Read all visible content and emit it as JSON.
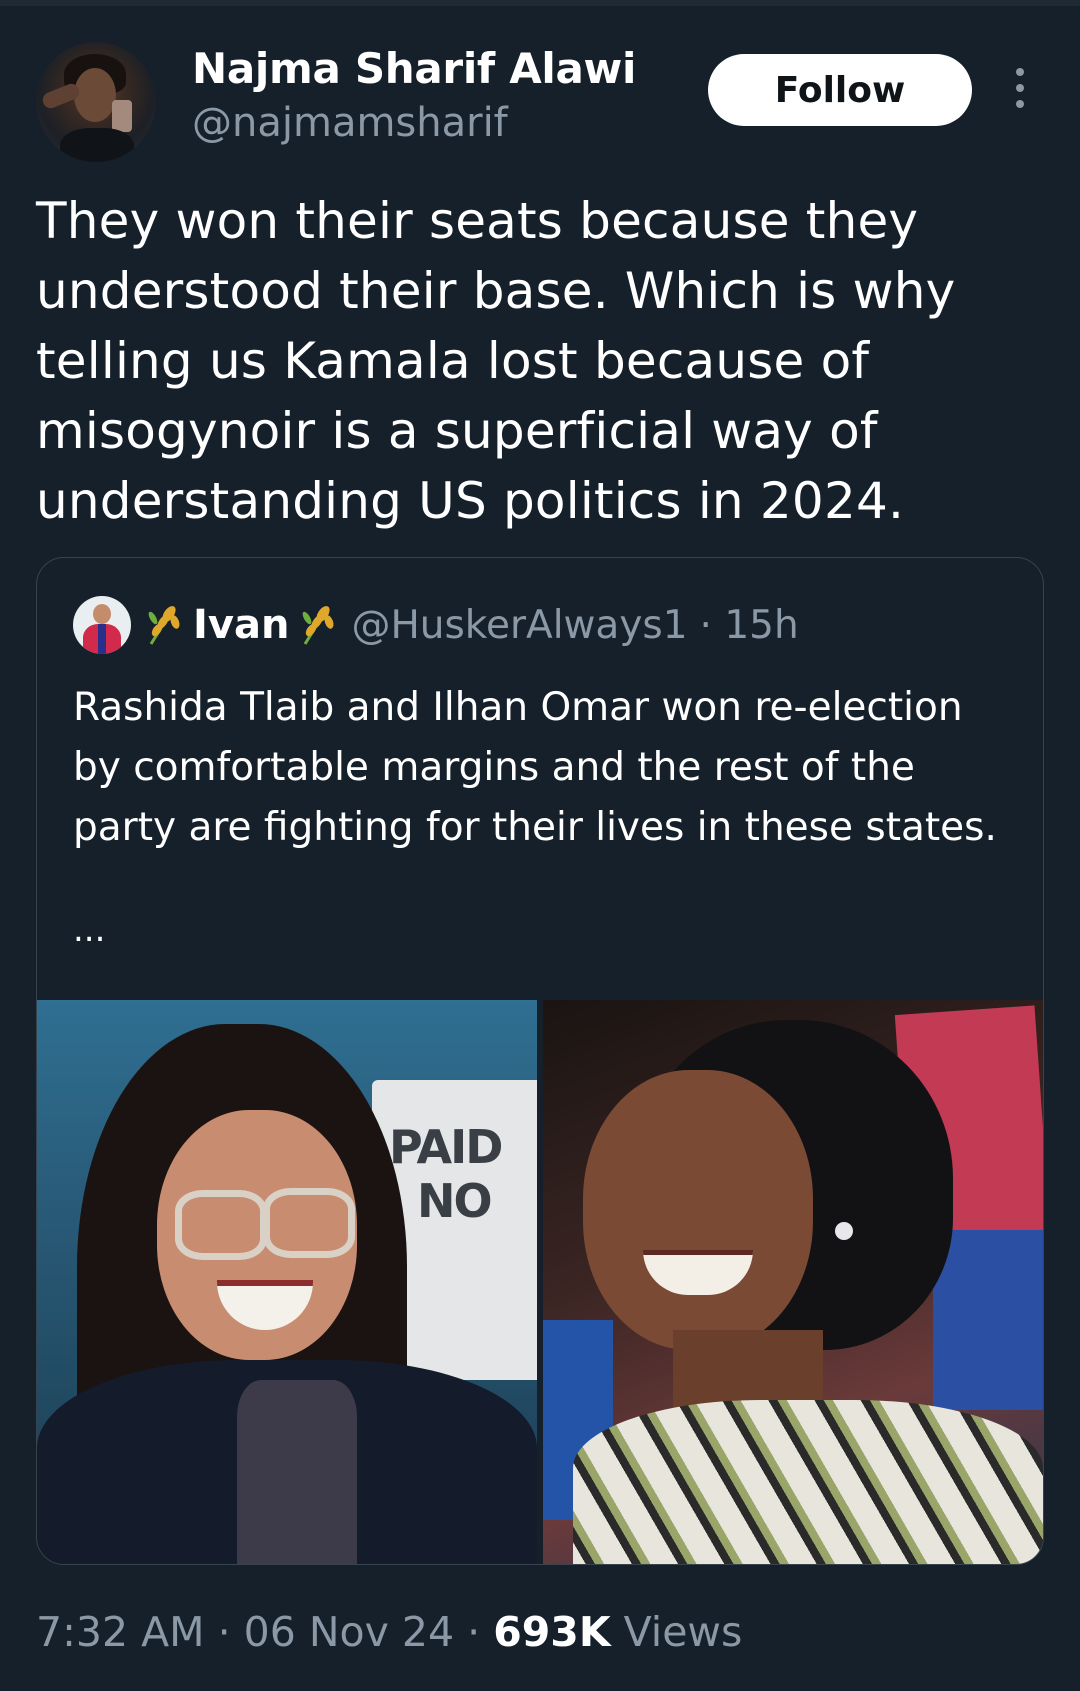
{
  "tweet": {
    "author": {
      "display_name": "Najma Sharif Alawi",
      "handle": "@najmamsharif",
      "avatar": "profile-photo"
    },
    "follow_label": "Follow",
    "more_icon": "more-vertical-icon",
    "text": "They won their seats because they understood their base. Which is why telling us Kamala lost because of misogynoir is a superficial way of understanding US politics in 2024.",
    "time": "7:32 AM",
    "date": "06 Nov 24",
    "separator": "·",
    "views_count": "693K",
    "views_label": "Views"
  },
  "quoted_tweet": {
    "display_name": "Ivan",
    "name_emoji": "wheat-icon",
    "handle": "@HuskerAlways1",
    "age": "· 15h",
    "text": "Rashida Tlaib and Ilhan Omar won re-election by comfortable margins and the rest of the party are fighting for their lives in these states.",
    "ellipsis": "...",
    "images": [
      {
        "name": "photo-left",
        "sign_text": "PAID\nNO"
      },
      {
        "name": "photo-right"
      }
    ]
  },
  "colors": {
    "background": "#15202b",
    "secondary_text": "#8b98a5",
    "border": "#38444d",
    "follow_bg": "#ffffff"
  }
}
